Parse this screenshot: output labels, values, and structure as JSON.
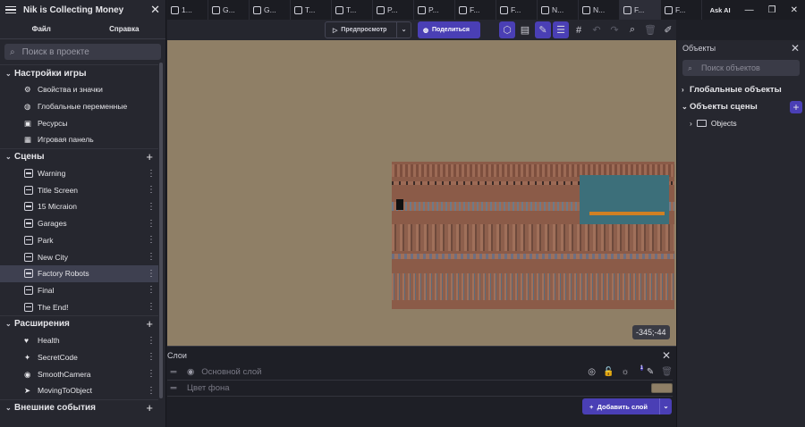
{
  "project": {
    "title": "Nik is Collecting Money",
    "tabs": [
      "Файл",
      "Справка"
    ],
    "search_placeholder": "Поиск в проекте",
    "sections": {
      "settings": {
        "title": "Настройки игры",
        "items": [
          "Свойства и значки",
          "Глобальные переменные",
          "Ресурсы",
          "Игровая панель"
        ]
      },
      "scenes": {
        "title": "Сцены",
        "items": [
          "Warning",
          "Title Screen",
          "15 Micraion",
          "Garages",
          "Park",
          "New City",
          "Factory Robots",
          "Final",
          "The End!"
        ],
        "selected": "Factory Robots"
      },
      "extensions": {
        "title": "Расширения",
        "items": [
          "Health",
          "SecretCode",
          "SmoothCamera",
          "MovingToObject"
        ]
      },
      "external": {
        "title": "Внешние события"
      }
    }
  },
  "top_tabs": [
    {
      "label": "1...",
      "active": false
    },
    {
      "label": "G...",
      "active": false
    },
    {
      "label": "G...",
      "active": false
    },
    {
      "label": "T...",
      "active": false
    },
    {
      "label": "T...",
      "active": false
    },
    {
      "label": "P...",
      "active": false
    },
    {
      "label": "P...",
      "active": false
    },
    {
      "label": "F...",
      "active": false
    },
    {
      "label": "F...",
      "active": false
    },
    {
      "label": "N...",
      "active": false
    },
    {
      "label": "N...",
      "active": false
    },
    {
      "label": "F...",
      "active": true
    },
    {
      "label": "F...",
      "active": false
    }
  ],
  "window": {
    "ask_ai": "Ask AI"
  },
  "toolbar": {
    "preview": "Предпросмотр",
    "share": "Поделиться"
  },
  "canvas": {
    "coordinates": "-345;-44"
  },
  "objects_panel": {
    "title": "Объекты",
    "search_placeholder": "Поиск объектов",
    "global_objects": "Глобальные объекты",
    "scene_objects": "Объекты сцены",
    "folder": "Objects"
  },
  "layers_panel": {
    "title": "Слои",
    "base_layer": "Основной слой",
    "background_color": "Цвет фона",
    "lights_count": "1",
    "add_layer": "Добавить слой"
  },
  "colors": {
    "accent": "#4a3fb5",
    "canvas_bg": "#8f7f66"
  }
}
